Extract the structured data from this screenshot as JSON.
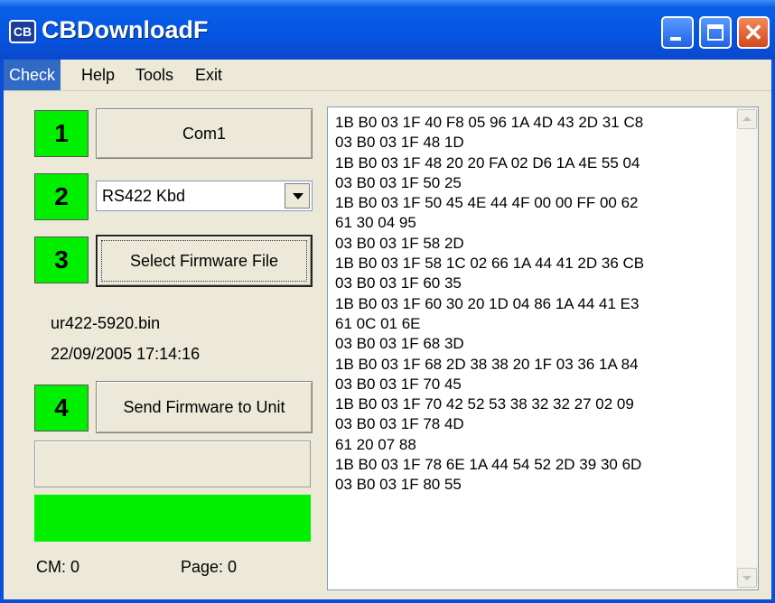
{
  "window": {
    "title": "CBDownloadF",
    "icon_text": "CB",
    "colors": {
      "titlebar": "#0556e3",
      "badge_green": "#00f000",
      "menu_active": "#316ac5"
    }
  },
  "menu": [
    "Check",
    "Help",
    "Tools",
    "Exit"
  ],
  "steps": [
    {
      "number": "1",
      "button": "Com1"
    },
    {
      "number": "2",
      "select_value": "RS422 Kbd"
    },
    {
      "number": "3",
      "button": "Select Firmware File"
    },
    {
      "number": "4",
      "button": "Send Firmware to Unit"
    }
  ],
  "file": {
    "name": "ur422-5920.bin",
    "timestamp": "22/09/2005 17:14:16"
  },
  "progress": {
    "top_bar": 0,
    "bottom_bar": 1.0
  },
  "status": {
    "cm": "CM: 0",
    "page": "Page: 0"
  },
  "log": [
    "1B B0 03 1F 40 F8 05 96 1A 4D 43 2D 31 C8",
    "03 B0 03 1F 48 1D",
    "1B B0 03 1F 48 20 20 FA 02 D6 1A 4E 55 04",
    "03 B0 03 1F 50 25",
    "1B B0 03 1F 50 45 4E 44 4F 00 00 FF 00 62",
    "61 30 04 95",
    "03 B0 03 1F 58 2D",
    "1B B0 03 1F 58 1C 02 66 1A 44 41 2D 36 CB",
    "03 B0 03 1F 60 35",
    "1B B0 03 1F 60 30 20 1D 04 86 1A 44 41 E3",
    "61 0C 01 6E",
    "03 B0 03 1F 68 3D",
    "1B B0 03 1F 68 2D 38 38 20 1F 03 36 1A 84",
    "03 B0 03 1F 70 45",
    "1B B0 03 1F 70 42 52 53 38 32 32 27 02 09",
    "03 B0 03 1F 78 4D",
    "61 20 07 88",
    "1B B0 03 1F 78 6E 1A 44 54 52 2D 39 30 6D",
    "03 B0 03 1F 80 55"
  ]
}
